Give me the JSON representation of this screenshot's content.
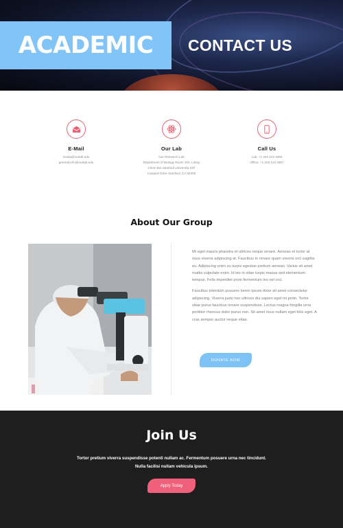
{
  "hero": {
    "brand": "ACADEMIC",
    "title": "CONTACT US"
  },
  "contact": {
    "email": {
      "icon": "envelope-icon",
      "title": "E-Mail",
      "lines": [
        "media@ourlab.edu",
        "general.info@ourlab.edu"
      ]
    },
    "lab": {
      "icon": "atom-icon",
      "title": "Our Lab",
      "lines": [
        "Our Research Lab",
        "Department of Biology Room 104, Lokey",
        "Chem Bio Stanford University 337",
        "Campus Drive Stanford, CA 94305"
      ]
    },
    "call": {
      "icon": "phone-icon",
      "title": "Call Us",
      "lines": [
        "Lab: +1 204 123 3456",
        "Office: +1 203 123 4567"
      ]
    }
  },
  "about": {
    "title": "About Our Group",
    "paragraphs": [
      "Mi eget mauris pharetra et ultrices neque ornare. Aenean et tortor at risus viverra adipiscing at. Faucibus in ornare quam viverra orci sagittis eu. Adipiscing enim eu turpis egestas pretium aenean. Varius sit amet mattis vulputate enim. Id leo in vitae turpis massa sed elementum tempus. Felis imperdiet proin fermentum leo vel orci.",
      "Faucibus interdum posuere lorem ipsum dolor sit amet consectetur adipiscing. Viverra justo nec ultrices dui sapien eget mi proin. Tortor vitae purus faucibus ornare suspendisse. Lectus magna fringilla urna porttitor rhoncus dolor purus non. Sit amet risus nullam eget felis eget. A cras semper auctor neque vitae."
    ],
    "button": "DONATE NOW"
  },
  "join": {
    "title": "Join Us",
    "text": "Tortor pretium viverra suspendisse potenti nullam ac. Fermentum posuere urna nec tincidunt. Nulla facilisi nullam vehicula ipsum.",
    "button": "Apply Today"
  },
  "colors": {
    "accent_blue": "#80c4f8",
    "accent_pink": "#ef5f71",
    "dark": "#1e1e1f"
  }
}
